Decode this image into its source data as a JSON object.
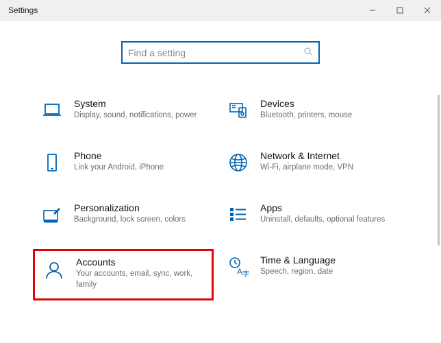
{
  "window": {
    "title": "Settings"
  },
  "search": {
    "placeholder": "Find a setting"
  },
  "categories": [
    {
      "name": "System",
      "desc": "Display, sound, notifications, power"
    },
    {
      "name": "Devices",
      "desc": "Bluetooth, printers, mouse"
    },
    {
      "name": "Phone",
      "desc": "Link your Android, iPhone"
    },
    {
      "name": "Network & Internet",
      "desc": "Wi-Fi, airplane mode, VPN"
    },
    {
      "name": "Personalization",
      "desc": "Background, lock screen, colors"
    },
    {
      "name": "Apps",
      "desc": "Uninstall, defaults, optional features"
    },
    {
      "name": "Accounts",
      "desc": "Your accounts, email, sync, work, family"
    },
    {
      "name": "Time & Language",
      "desc": "Speech, region, date"
    }
  ]
}
